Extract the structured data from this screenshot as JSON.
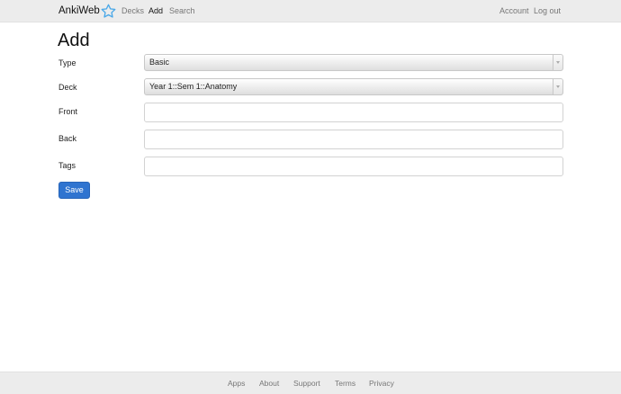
{
  "navbar": {
    "brand": "AnkiWeb",
    "links": {
      "decks": "Decks",
      "add": "Add",
      "search": "Search",
      "account": "Account",
      "logout": "Log out"
    },
    "active": "add",
    "brand_icon": "star-icon",
    "brand_icon_color": "#4aa8e8"
  },
  "page": {
    "title": "Add"
  },
  "form": {
    "type": {
      "label": "Type",
      "value": "Basic"
    },
    "deck": {
      "label": "Deck",
      "value": "Year 1::Sem 1::Anatomy"
    },
    "front": {
      "label": "Front",
      "value": ""
    },
    "back": {
      "label": "Back",
      "value": ""
    },
    "tags": {
      "label": "Tags",
      "value": ""
    },
    "save_label": "Save"
  },
  "footer": {
    "links": [
      "Apps",
      "About",
      "Support",
      "Terms",
      "Privacy"
    ]
  },
  "colors": {
    "accent": "#2f74d0",
    "nav_background": "#ececec"
  }
}
